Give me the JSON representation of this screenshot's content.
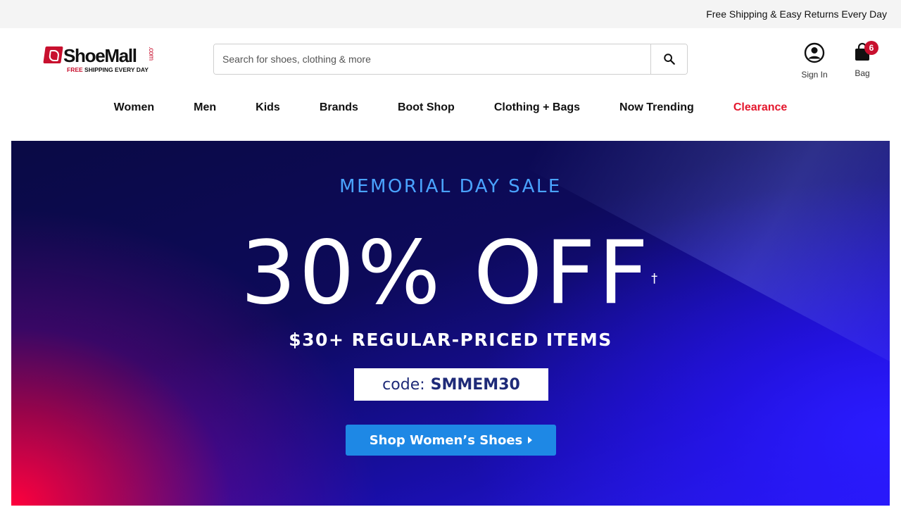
{
  "topbar": {
    "message": "Free Shipping & Easy Returns Every Day"
  },
  "logo": {
    "name": "ShoeMall",
    "com": ".com",
    "tagline_free": "FREE",
    "tagline_rest": " SHIPPING EVERY DAY"
  },
  "search": {
    "placeholder": "Search for shoes, clothing & more",
    "value": ""
  },
  "account": {
    "label": "Sign In"
  },
  "bag": {
    "label": "Bag",
    "count": "6"
  },
  "nav": {
    "items": [
      {
        "label": "Women"
      },
      {
        "label": "Men"
      },
      {
        "label": "Kids"
      },
      {
        "label": "Brands"
      },
      {
        "label": "Boot Shop"
      },
      {
        "label": "Clothing + Bags"
      },
      {
        "label": "Now Trending"
      },
      {
        "label": "Clearance"
      }
    ]
  },
  "hero": {
    "kicker": "MEMORIAL DAY SALE",
    "headline": "30% OFF",
    "dagger": "†",
    "subhead": "$30+ REGULAR-PRICED ITEMS",
    "code_label": "code:",
    "code_value": "SMMEM30",
    "cta_label": "Shop Women’s Shoes"
  },
  "colors": {
    "brand_red": "#c8102e",
    "clearance_red": "#e4172d",
    "cta_blue": "#1e88e5",
    "kicker_blue": "#4aa3ff"
  }
}
